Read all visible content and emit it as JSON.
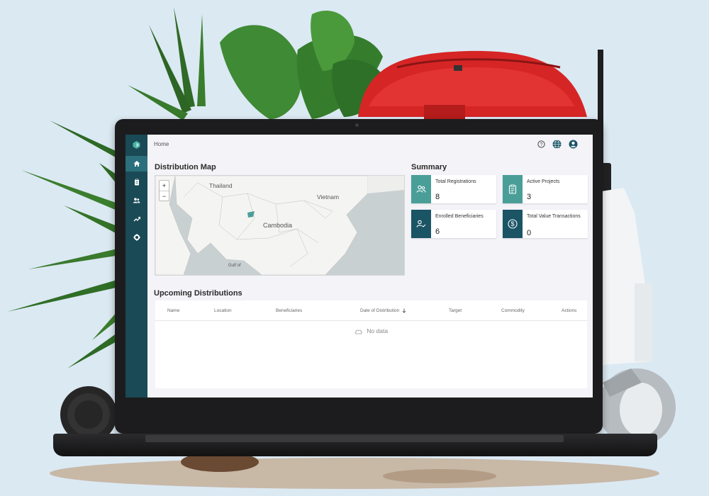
{
  "page": {
    "breadcrumb": "Home"
  },
  "sidebar": {
    "items": [
      {
        "name": "home",
        "icon": "home-icon",
        "active": true
      },
      {
        "name": "projects",
        "icon": "clipboard-icon",
        "active": false
      },
      {
        "name": "beneficiaries",
        "icon": "people-icon",
        "active": false
      },
      {
        "name": "reports",
        "icon": "trend-icon",
        "active": false
      },
      {
        "name": "settings",
        "icon": "gear-icon",
        "active": false
      }
    ]
  },
  "header": {
    "help_icon": "help-icon",
    "language_icon": "globe-icon",
    "profile_icon": "avatar-icon"
  },
  "map": {
    "title": "Distribution Map",
    "zoom_in": "+",
    "zoom_out": "−",
    "labels": {
      "thailand": "Thailand",
      "vietnam": "Vietnam",
      "cambodia": "Cambodia",
      "gulf": "Gulf of"
    }
  },
  "summary": {
    "title": "Summary",
    "cards": [
      {
        "label": "Total Registrations",
        "value": "8",
        "icon": "people-icon",
        "color": "#4a9e98"
      },
      {
        "label": "Active Projects",
        "value": "3",
        "icon": "clipboard-icon",
        "color": "#4a9e98"
      },
      {
        "label": "Enrolled Beneficiaries",
        "value": "6",
        "icon": "user-check-icon",
        "color": "#1a5465"
      },
      {
        "label": "Total Value Transactions",
        "value": "0",
        "icon": "dollar-icon",
        "color": "#1a5465"
      }
    ]
  },
  "distributions": {
    "title": "Upcoming Distributions",
    "columns": [
      "Name",
      "Location",
      "Beneficiaries",
      "Date of Distribution",
      "Target",
      "Commodity",
      "Actions"
    ],
    "sort_icon": "arrow-down-icon",
    "empty_text": "No data",
    "empty_icon": "cloud-icon"
  },
  "colors": {
    "sidebar": "#1a4a55",
    "sidebar_active": "#2b6f7c",
    "accent_teal": "#4a9e98",
    "accent_dark": "#1a5465"
  }
}
